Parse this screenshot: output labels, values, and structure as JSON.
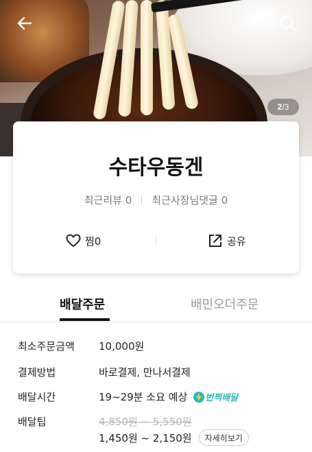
{
  "header": {
    "back_icon": "back-arrow-icon",
    "search_icon": "search-icon",
    "page_indicator": {
      "current": "2",
      "total": "/3"
    }
  },
  "store": {
    "name": "수타우동겐",
    "recent_reviews": "최근리뷰 0",
    "recent_owner_replies": "최근사장님댓글 0",
    "like_label": "찜0",
    "share_label": "공유"
  },
  "tabs": [
    {
      "label": "배달주문",
      "active": true
    },
    {
      "label": "배민오더주문",
      "active": false
    }
  ],
  "info": {
    "min_order": {
      "label": "최소주문금액",
      "value": "10,000원"
    },
    "payment": {
      "label": "결제방법",
      "value": "바로결제, 만나서결제"
    },
    "delivery_time": {
      "label": "배달시간",
      "value": "19~29분 소요 예상",
      "badge": "번쩍배달"
    },
    "delivery_tip": {
      "label": "배달팁",
      "original": "4,850원 ~ 5,550원",
      "value": "1,450원 ~ 2,150원",
      "detail_button": "자세히보기"
    }
  },
  "colors": {
    "accent": "#2bb7b7",
    "text": "#222222",
    "muted": "#9a9a9a"
  }
}
